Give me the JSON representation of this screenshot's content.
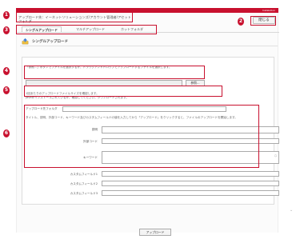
{
  "brand": {
    "text": "Instalution"
  },
  "header": {
    "breadcrumb_line1": "アップロード先：",
    "breadcrumb_line2": "フォルダ",
    "breadcrumb_path": "イーネットソリューションズ/アカウント管理者/アセット",
    "close_label": "閉じる"
  },
  "tabs": [
    {
      "label": "シングルアップロード"
    },
    {
      "label": "マルチアップロード"
    },
    {
      "label": "ホットフォルダ"
    }
  ],
  "section": {
    "title": "シングルアップロード"
  },
  "instructions": {
    "file_hint": "「参照...」ボタンでファイルを選択するか、ドラッグアンドドロップでアップロードするファイルを選択します。",
    "size_hint_1": "1回あたりのアップロードファイルサイズを確認します。",
    "size_hint_2": "Javaがインストールされているか、確認してください。ダウンロードされます。",
    "dest_label": "アップロード先フォルダ",
    "meta_hint": "タイトル、説明、外部コード、キーワード及びカスタムフィールドの値を入力してから「アップロード」をクリックすると、ファイルのアップロードを開始します。"
  },
  "file": {
    "browse_label": "参照..."
  },
  "fields": [
    {
      "label": "説明"
    },
    {
      "label": "外部コード"
    },
    {
      "label": "キーワード"
    },
    {
      "label": "カスタムフィールド1"
    },
    {
      "label": "カスタムフィールド2"
    },
    {
      "label": "カスタムフィールド3"
    }
  ],
  "upload": {
    "label": "アップロード"
  },
  "callouts": [
    "1",
    "2",
    "3",
    "4",
    "5",
    "6"
  ],
  "colors": {
    "accent": "#c8102e"
  }
}
